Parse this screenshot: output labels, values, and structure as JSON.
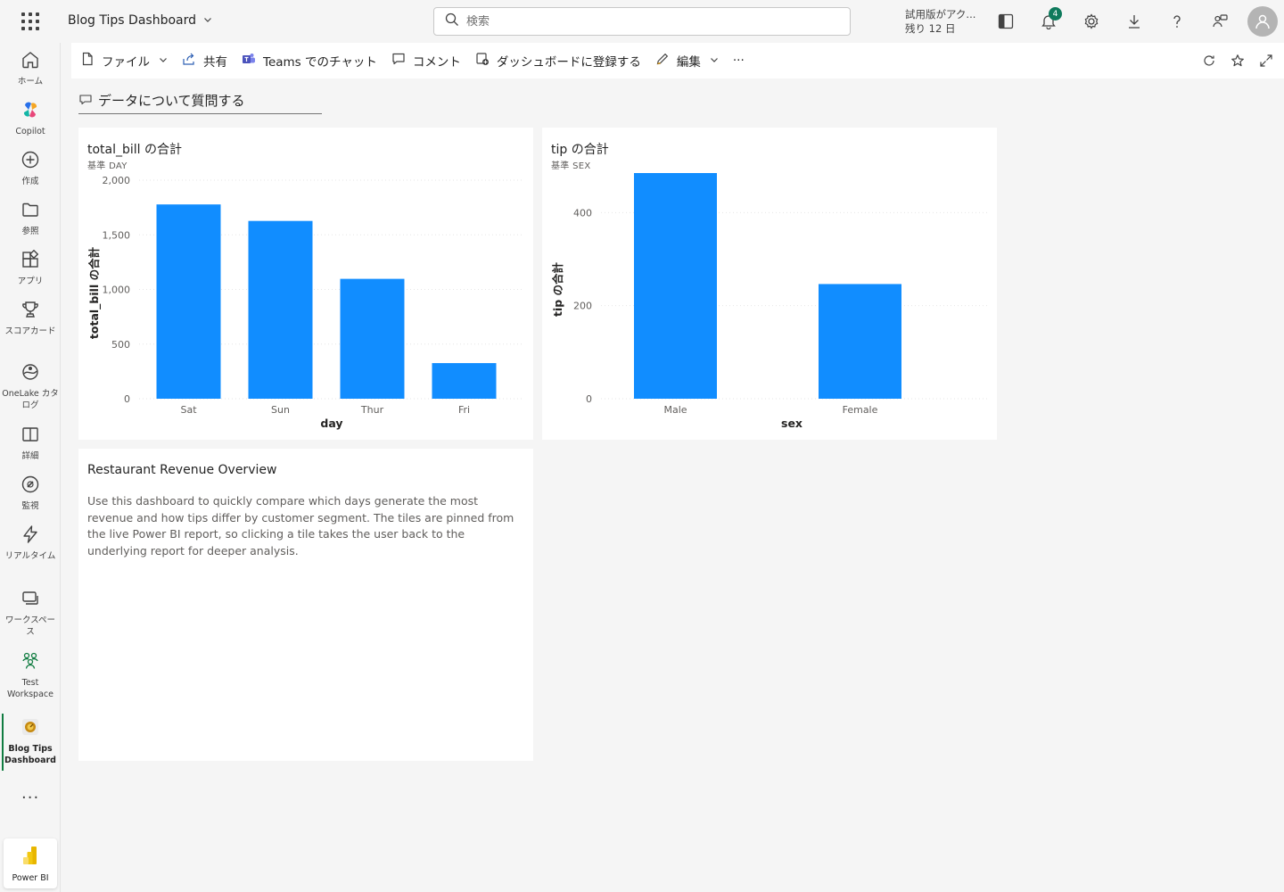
{
  "header": {
    "app_title": "Blog Tips Dashboard",
    "search_placeholder": "検索",
    "trial_line1": "試用版がアク...",
    "trial_line2": "残り 12 日",
    "notification_count": "4"
  },
  "nav": {
    "items": [
      {
        "label": "ホーム",
        "icon": "home-icon"
      },
      {
        "label": "Copilot",
        "icon": "copilot-icon"
      },
      {
        "label": "作成",
        "icon": "create-icon"
      },
      {
        "label": "参照",
        "icon": "browse-icon"
      },
      {
        "label": "アプリ",
        "icon": "apps-icon"
      },
      {
        "label": "スコアカード",
        "icon": "scorecard-icon"
      },
      {
        "label": "OneLake カタログ",
        "icon": "onelake-icon"
      },
      {
        "label": "詳細",
        "icon": "learn-icon"
      },
      {
        "label": "監視",
        "icon": "monitor-icon"
      },
      {
        "label": "リアルタイム",
        "icon": "realtime-icon"
      },
      {
        "label": "ワークスペース",
        "icon": "workspaces-icon"
      },
      {
        "label": "Test Workspace",
        "icon": "workspace-icon"
      },
      {
        "label": "Blog Tips Dashboard",
        "icon": "dashboard-icon"
      }
    ],
    "more": "···",
    "product": "Power BI"
  },
  "toolbar": {
    "file": "ファイル",
    "share": "共有",
    "teams": "Teams でのチャット",
    "comment": "コメント",
    "subscribe": "ダッシュボードに登録する",
    "edit": "編集",
    "more": "···"
  },
  "qa": {
    "label": "データについて質問する"
  },
  "tiles": {
    "bill": {
      "title": "total_bill の合計",
      "subtitle": "基準 DAY"
    },
    "tip": {
      "title": "tip の合計",
      "subtitle": "基準 SEX"
    },
    "text": {
      "title": "Restaurant Revenue Overview",
      "body": "Use this dashboard to quickly compare which days generate the most revenue and how tips differ by customer segment. The tiles are pinned from the live Power BI report, so clicking a tile takes the user back to the underlying report for deeper analysis."
    }
  },
  "colors": {
    "bar": "#118DFF",
    "accent": "#107c41"
  },
  "chart_data": [
    {
      "type": "bar",
      "categories": [
        "Sat",
        "Sun",
        "Thur",
        "Fri"
      ],
      "values": [
        1778,
        1627,
        1097,
        326
      ],
      "xlabel": "day",
      "ylabel": "total_bill の合計",
      "ylim": [
        0,
        2000
      ],
      "yticks": [
        0,
        500,
        1000,
        1500,
        2000
      ],
      "ytick_labels": [
        "0",
        "500",
        "1,000",
        "1,500",
        "2,000"
      ],
      "grid": true
    },
    {
      "type": "bar",
      "categories": [
        "Male",
        "Female"
      ],
      "values": [
        485.07,
        246.51
      ],
      "xlabel": "sex",
      "ylabel": "tip の合計",
      "ylim": [
        0,
        485.07
      ],
      "yticks": [
        0,
        200,
        400
      ],
      "ytick_labels": [
        "0",
        "200",
        "400"
      ],
      "grid": true
    }
  ]
}
